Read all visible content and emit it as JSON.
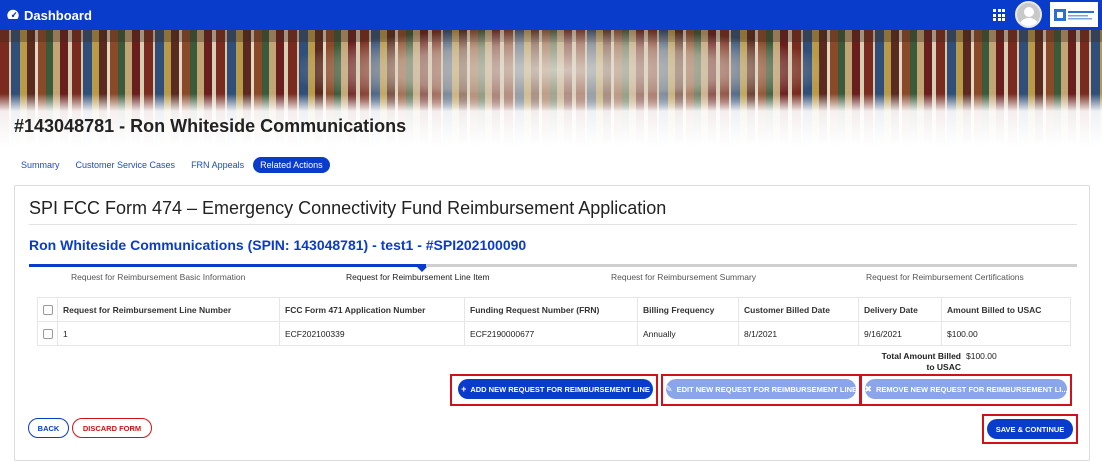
{
  "topbar": {
    "title": "Dashboard",
    "icons": {
      "dashboard": "dashboard-icon",
      "apps": "apps-grid-icon",
      "avatar": "avatar"
    },
    "accent": "#0a3ccc"
  },
  "page": {
    "title": "#143048781 - Ron Whiteside Communications"
  },
  "tabs": [
    {
      "label": "Summary",
      "active": false
    },
    {
      "label": "Customer Service Cases",
      "active": false
    },
    {
      "label": "FRN Appeals",
      "active": false
    },
    {
      "label": "Related Actions",
      "active": true
    }
  ],
  "form": {
    "title": "SPI FCC Form 474 – Emergency Connectivity Fund Reimbursement Application",
    "subtitle": "Ron Whiteside Communications (SPIN: 143048781) - test1 - #SPI202100090",
    "steps": [
      {
        "label": "Request for Reimbursement Basic Information",
        "active": false
      },
      {
        "label": "Request for Reimbursement Line Item",
        "active": true
      },
      {
        "label": "Request for Reimbursement Summary",
        "active": false
      },
      {
        "label": "Request for Reimbursement Certifications",
        "active": false
      }
    ],
    "table": {
      "headers": [
        "Request for Reimbursement Line Number",
        "FCC Form 471 Application Number",
        "Funding Request Number (FRN)",
        "Billing Frequency",
        "Customer Billed Date",
        "Delivery Date",
        "Amount Billed to USAC"
      ],
      "rows": [
        [
          "1",
          "ECF202100339",
          "ECF2190000677",
          "Annually",
          "8/1/2021",
          "9/16/2021",
          "$100.00"
        ]
      ]
    },
    "total": {
      "label_line1": "Total Amount Billed",
      "label_line2": "to USAC",
      "value": "$100.00"
    },
    "buttons": {
      "add_line": "ADD NEW REQUEST FOR REIMBURSEMENT LINE",
      "edit_line": "EDIT NEW REQUEST FOR REIMBURSEMENT LINE",
      "remove_line": "REMOVE NEW REQUEST FOR REIMBURSEMENT LI...",
      "back": "BACK",
      "discard": "DISCARD FORM",
      "save_continue": "SAVE & CONTINUE"
    },
    "colors": {
      "primary": "#0a3ccc",
      "highlight": "#d0111b",
      "disabled": "#8aa5ea"
    }
  }
}
